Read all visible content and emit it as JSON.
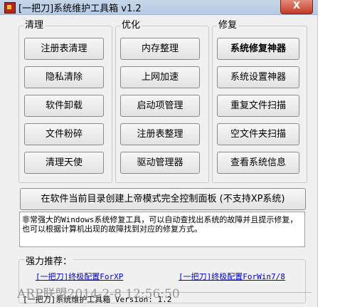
{
  "window": {
    "title": "[一把刀]系统维护工具箱 v1.2",
    "close_label": "X"
  },
  "groups": {
    "clean": {
      "label": "清理",
      "buttons": [
        "注册表清理",
        "隐私清除",
        "软件卸载",
        "文件粉碎",
        "清理天使"
      ]
    },
    "optimize": {
      "label": "优化",
      "buttons": [
        "内存整理",
        "上网加速",
        "启动项管理",
        "注册表整理",
        "驱动管理器"
      ]
    },
    "repair": {
      "label": "修复",
      "buttons": [
        "系统修复神器",
        "系统设置神器",
        "重复文件扫描",
        "空文件夹扫描",
        "查看系统信息"
      ]
    }
  },
  "wide_button": "在软件当前目录创建上帝模式完全控制面板 (不支持XP系统)",
  "description": "非常强大的Windows系统修复工具，可以自动查找出系统的故障并且提示修复，也可以根据计算机出现的故障找到对应的修复方式。",
  "recommend": {
    "label": "强力推荐：",
    "link_xp": "[一把刀]终极配置ForXP",
    "link_win7": "[一把刀]终极配置ForWin7/8"
  },
  "status": "[一把刀]系统维护工具箱 Version: 1.2",
  "watermark": "ARP联盟2014-2-8 12:56:50"
}
